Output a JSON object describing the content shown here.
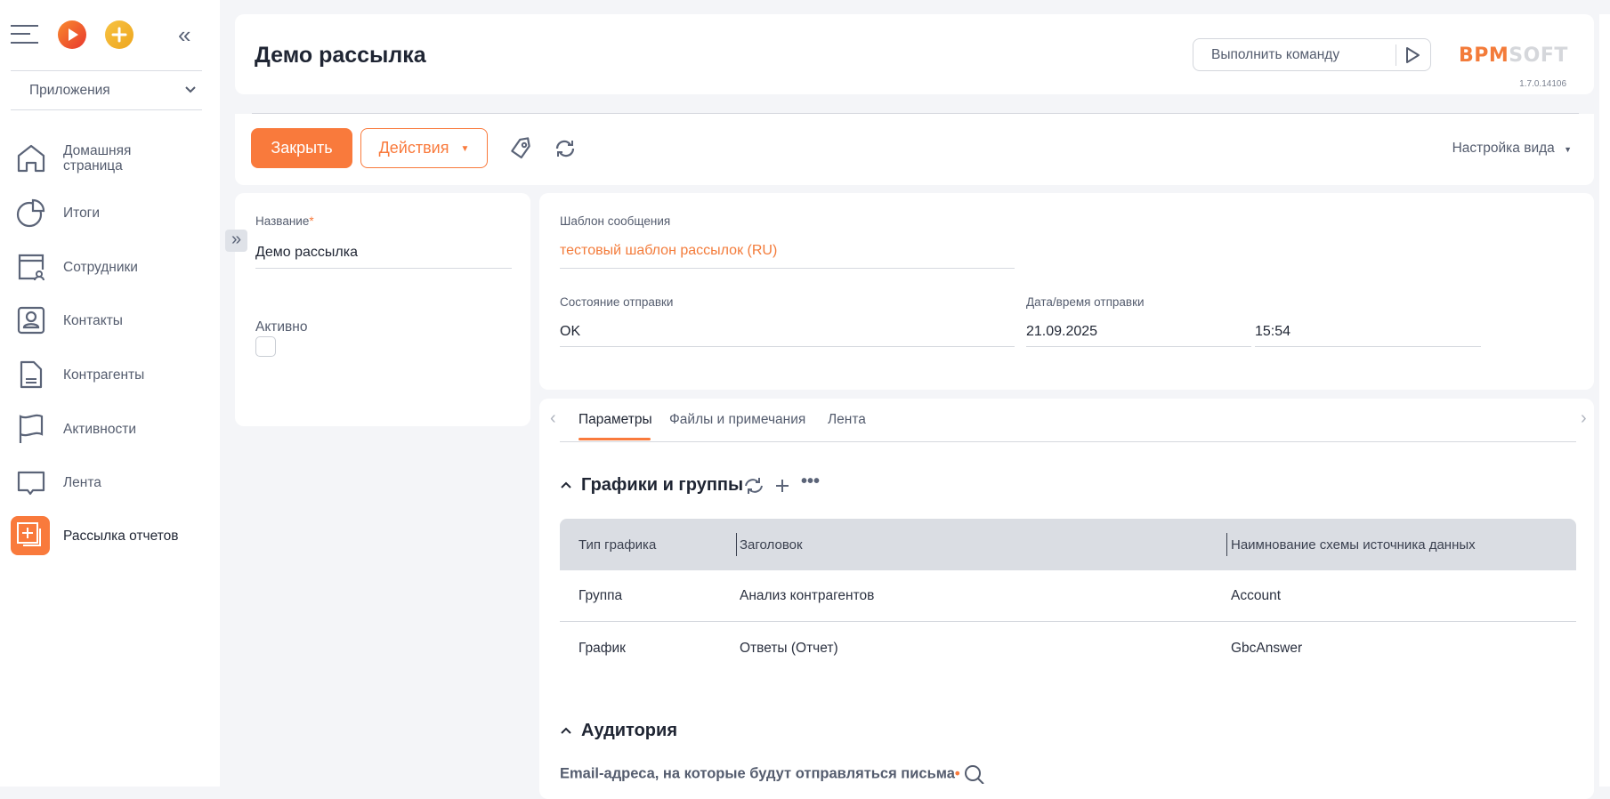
{
  "sidebar": {
    "apps_label": "Приложения",
    "items": [
      {
        "label": "Домашняя страница",
        "icon": "home-icon"
      },
      {
        "label": "Итоги",
        "icon": "pie-chart-icon"
      },
      {
        "label": "Сотрудники",
        "icon": "employees-icon"
      },
      {
        "label": "Контакты",
        "icon": "contact-icon"
      },
      {
        "label": "Контрагенты",
        "icon": "document-icon"
      },
      {
        "label": "Активности",
        "icon": "flag-icon"
      },
      {
        "label": "Лента",
        "icon": "chat-icon"
      },
      {
        "label": "Рассылка отчетов",
        "icon": "report-mailing-icon",
        "active": true
      }
    ]
  },
  "header": {
    "title": "Демо рассылка",
    "command_placeholder": "Выполнить команду",
    "logo_text": "BPMSOFT",
    "version": "1.7.0.14106"
  },
  "toolbar": {
    "close_label": "Закрыть",
    "actions_label": "Действия",
    "view_settings_label": "Настройка вида"
  },
  "form": {
    "name_label": "Название",
    "name_value": "Демо рассылка",
    "active_label": "Активно",
    "active_checked": false,
    "template_label": "Шаблон сообщения",
    "template_value": "тестовый шаблон рассылок (RU)",
    "status_label": "Состояние отправки",
    "status_value": "OK",
    "datetime_label": "Дата/время отправки",
    "date_value": "21.09.2025",
    "time_value": "15:54"
  },
  "tabs": [
    {
      "label": "Параметры",
      "active": true
    },
    {
      "label": "Файлы и примечания"
    },
    {
      "label": "Лента"
    }
  ],
  "charts_section": {
    "title": "Графики и группы",
    "columns": [
      "Тип графика",
      "Заголовок",
      "Наимнование схемы источника данных"
    ],
    "rows": [
      [
        "Группа",
        "Анализ контрагентов",
        "Account"
      ],
      [
        "График",
        "Ответы (Отчет)",
        "GbcAnswer"
      ]
    ]
  },
  "audience_section": {
    "title": "Аудитория",
    "email_label": "Email-адреса, на которые будут отправляться письма"
  },
  "colors": {
    "accent": "#f97a3c",
    "text": "#1f2533",
    "muted": "#545c6e"
  }
}
